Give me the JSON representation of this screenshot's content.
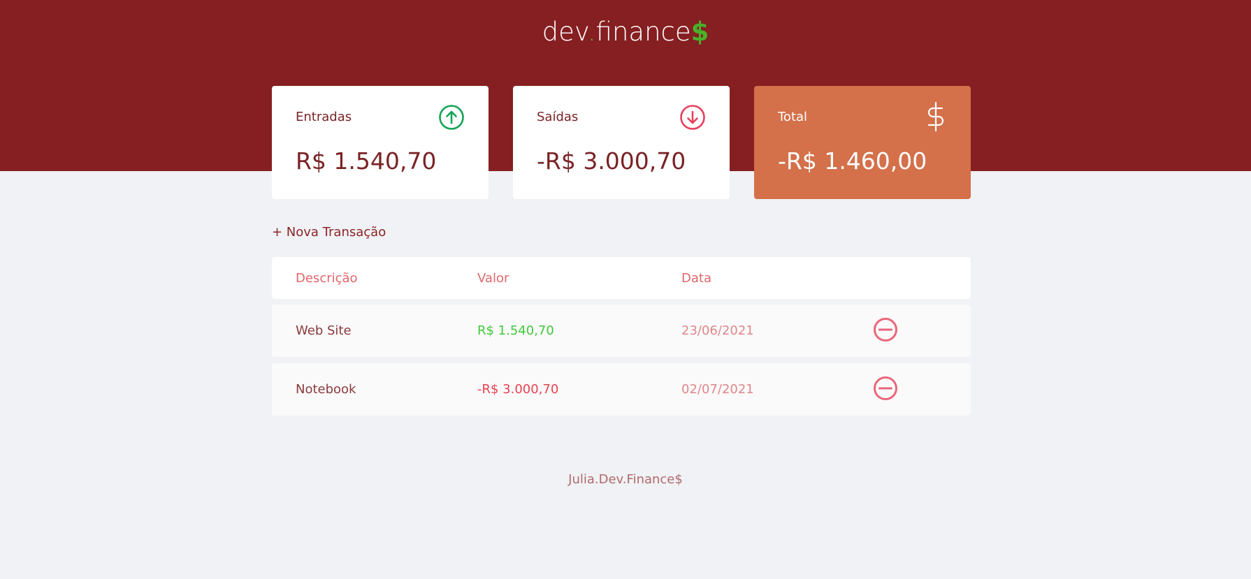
{
  "header": {
    "logo_part1": "dev",
    "logo_dot": ".",
    "logo_part2": "finance",
    "logo_dollar": "$"
  },
  "cards": {
    "income": {
      "label": "Entradas",
      "value": "R$ 1.540,70",
      "icon": "arrow-up-circle-icon"
    },
    "expense": {
      "label": "Saídas",
      "value": "-R$ 3.000,70",
      "icon": "arrow-down-circle-icon"
    },
    "total": {
      "label": "Total",
      "value": "-R$ 1.460,00",
      "icon": "dollar-sign-icon"
    }
  },
  "actions": {
    "new_transaction": "+ Nova Transação"
  },
  "table": {
    "columns": {
      "description": "Descrição",
      "amount": "Valor",
      "date": "Data"
    },
    "rows": [
      {
        "description": "Web Site",
        "amount": "R$ 1.540,70",
        "date": "23/06/2021",
        "type": "income"
      },
      {
        "description": "Notebook",
        "amount": "-R$ 3.000,70",
        "date": "02/07/2021",
        "type": "expense"
      }
    ]
  },
  "footer": {
    "text": "Julia.Dev.Finance$"
  },
  "colors": {
    "header": "#861f21",
    "background": "#f0f2f5",
    "total_card": "#d4704a",
    "income": "#3fc93a",
    "expense": "#e8424f",
    "income_icon": "#12a454",
    "expense_icon": "#e83f5b"
  }
}
